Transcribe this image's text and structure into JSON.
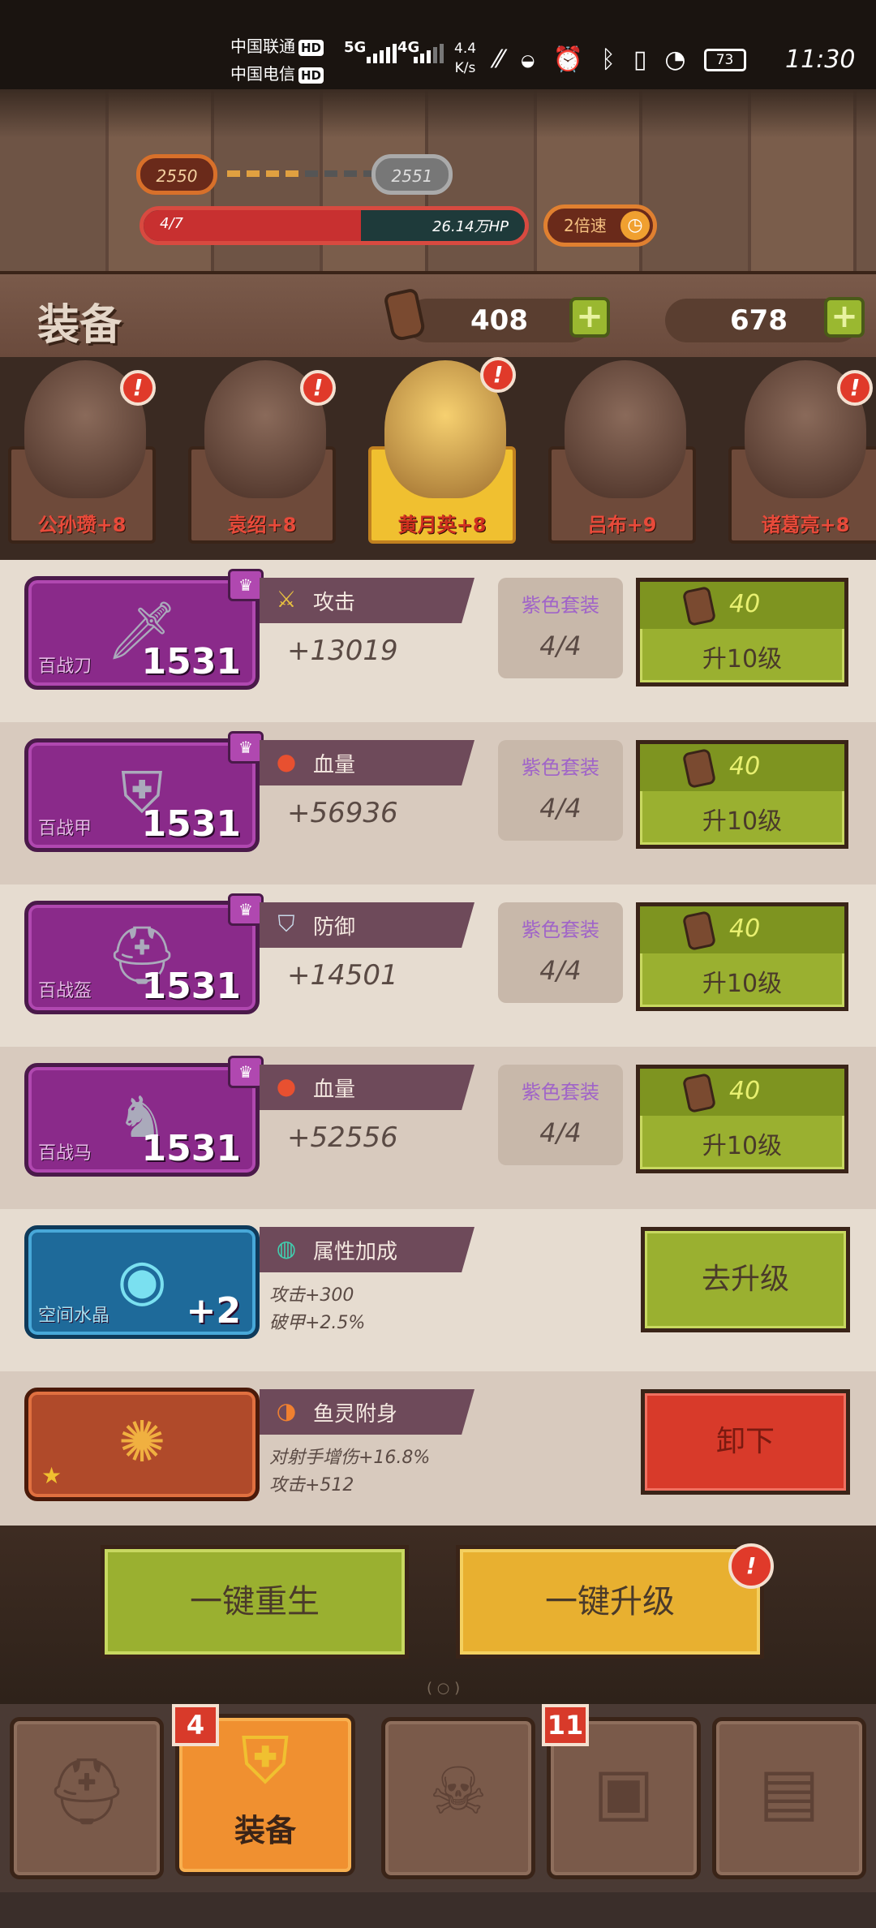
{
  "status": {
    "carrier1": "中国联通",
    "carrier2": "中国电信",
    "hd": "HD",
    "net1": "5G",
    "net2": "4G",
    "speed_value": "4.4",
    "speed_unit": "K/s",
    "battery": "73",
    "time": "11:30"
  },
  "battle": {
    "wave_current": "2550",
    "wave_next": "2551",
    "progress": "4/7",
    "progress_fraction": 0.57,
    "boss_hp": "26.14万HP",
    "speed_label": "2倍速"
  },
  "header": {
    "title": "装备",
    "currency1": "408",
    "currency2": "678"
  },
  "heroes": [
    {
      "label": "公孙瓒+8",
      "alert": "!"
    },
    {
      "label": "袁绍+8",
      "alert": "!"
    },
    {
      "label": "黄月英+8",
      "alert": "!"
    },
    {
      "label": "吕布+9",
      "alert": ""
    },
    {
      "label": "诸葛亮+8",
      "alert": "!"
    }
  ],
  "equipment": [
    {
      "name": "百战刀",
      "level": "1531",
      "stat": "攻击",
      "value": "+13019",
      "set": "紫色套装",
      "set_count": "4/4",
      "cost": "40",
      "upgrade": "升10级"
    },
    {
      "name": "百战甲",
      "level": "1531",
      "stat": "血量",
      "value": "+56936",
      "set": "紫色套装",
      "set_count": "4/4",
      "cost": "40",
      "upgrade": "升10级"
    },
    {
      "name": "百战盔",
      "level": "1531",
      "stat": "防御",
      "value": "+14501",
      "set": "紫色套装",
      "set_count": "4/4",
      "cost": "40",
      "upgrade": "升10级"
    },
    {
      "name": "百战马",
      "level": "1531",
      "stat": "血量",
      "value": "+52556",
      "set": "紫色套装",
      "set_count": "4/4",
      "cost": "40",
      "upgrade": "升10级"
    }
  ],
  "crystal": {
    "name": "空间水晶",
    "level": "+2",
    "stat": "属性加成",
    "line1": "攻击+300",
    "line2": "破甲+2.5%",
    "button": "去升级"
  },
  "fish": {
    "stat": "鱼灵附身",
    "line1": "对射手增伤+16.8%",
    "line2": "攻击+512",
    "button": "卸下"
  },
  "actions": {
    "rebirth": "一键重生",
    "upgrade_all": "一键升级",
    "upgrade_alert": "!"
  },
  "nav": {
    "tabs": [
      {
        "label": "",
        "icon": "hero-helmet-icon"
      },
      {
        "label": "装备",
        "icon": "armor-icon",
        "count": "4"
      },
      {
        "label": "",
        "icon": "skull-icon"
      },
      {
        "label": "",
        "icon": "chest-icon",
        "count": "11"
      },
      {
        "label": "",
        "icon": "map-icon"
      }
    ]
  }
}
